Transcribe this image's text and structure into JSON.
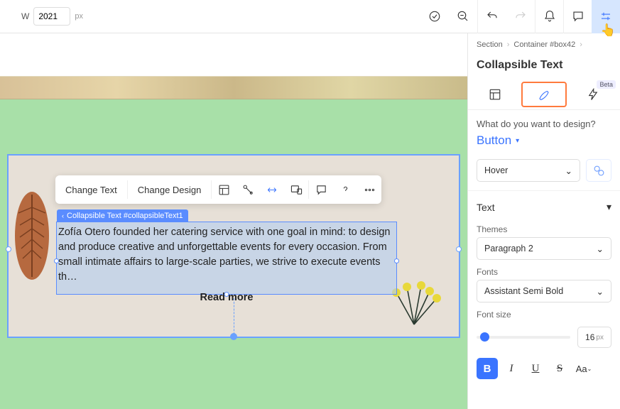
{
  "topbar": {
    "width_label": "W",
    "width_value": "2021",
    "width_unit": "px"
  },
  "breadcrumb": {
    "items": [
      "Section",
      "Container #box42"
    ]
  },
  "panel": {
    "title": "Collapsible Text",
    "beta_label": "Beta",
    "question": "What do you want to design?",
    "target": "Button",
    "state_select": "Hover",
    "sections": {
      "text": "Text",
      "themes_label": "Themes",
      "themes_value": "Paragraph 2",
      "fonts_label": "Fonts",
      "fonts_value": "Assistant Semi Bold",
      "fontsize_label": "Font size",
      "fontsize_value": "16",
      "fontsize_unit": "px"
    },
    "fmt": {
      "b": "B",
      "i": "I",
      "u": "U",
      "s": "S",
      "aa": "Aa"
    }
  },
  "canvas": {
    "toolbar": {
      "change_text": "Change Text",
      "change_design": "Change Design"
    },
    "selection_label": "Collapsible Text #collapsibleText1",
    "body_text": "Zofía Otero founded her catering service with one goal in mind: to design and produce creative and unforgettable events for every occasion. From small intimate affairs to large-scale parties, we strive to execute events th…",
    "read_more": "Read more"
  }
}
